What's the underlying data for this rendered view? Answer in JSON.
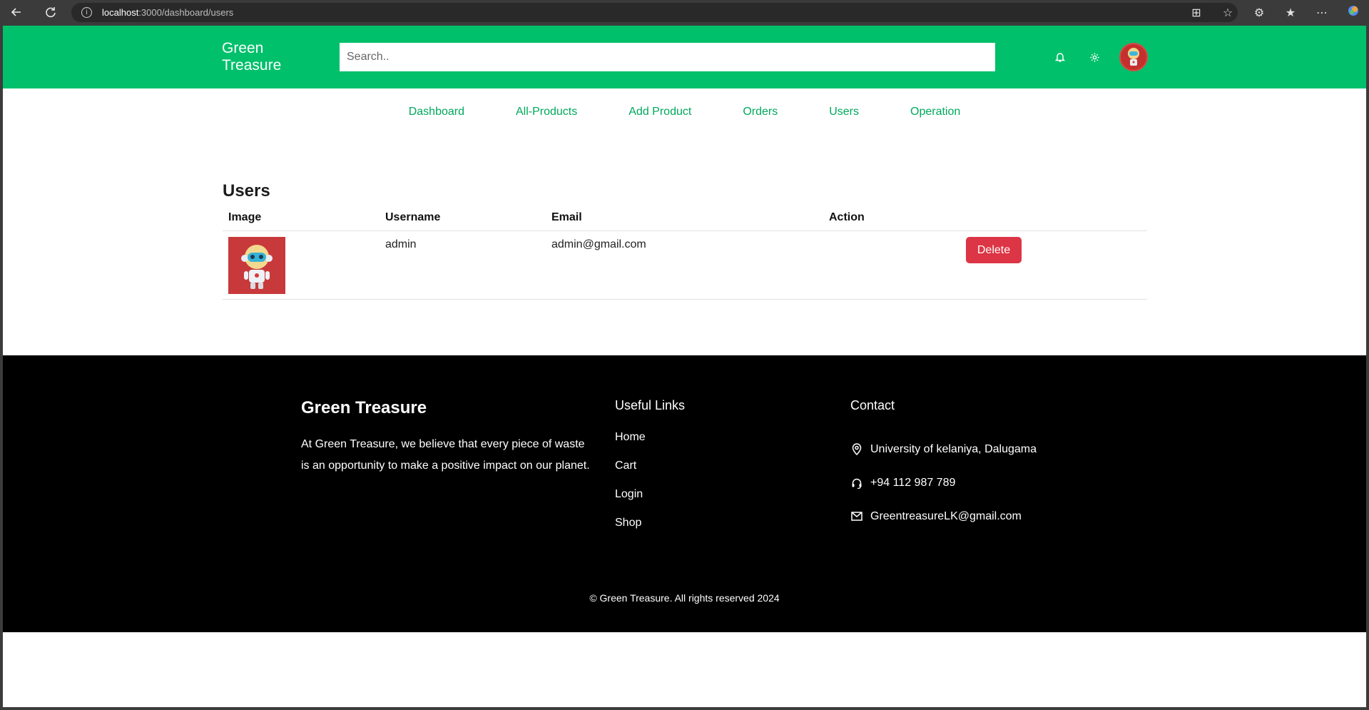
{
  "browser": {
    "url_host": "localhost",
    "url_path": ":3000/dashboard/users"
  },
  "header": {
    "brand_line1": "Green",
    "brand_line2": "Treasure",
    "search_placeholder": "Search..",
    "icons": [
      "bell-icon",
      "gear-icon",
      "avatar"
    ]
  },
  "nav": {
    "items": [
      "Dashboard",
      "All-Products",
      "Add Product",
      "Orders",
      "Users",
      "Operation"
    ]
  },
  "users": {
    "title": "Users",
    "columns": [
      "Image",
      "Username",
      "Email",
      "Action"
    ],
    "rows": [
      {
        "username": "admin",
        "email": "admin@gmail.com",
        "action": "Delete"
      }
    ]
  },
  "footer": {
    "brand": "Green Treasure",
    "description": "At Green Treasure, we believe that every piece of waste is an opportunity to make a positive impact on our planet.",
    "links_title": "Useful Links",
    "links": [
      "Home",
      "Cart",
      "Login",
      "Shop"
    ],
    "contact_title": "Contact",
    "address": "University of kelaniya, Dalugama",
    "phone": "+94 112 987 789",
    "email": "GreentreasureLK@gmail.com",
    "copyright": "© Green Treasure. All rights reserved 2024"
  },
  "colors": {
    "accent": "#00c06b",
    "nav_link": "#00a85d",
    "danger": "#dc3545",
    "footer_bg": "#000000"
  }
}
